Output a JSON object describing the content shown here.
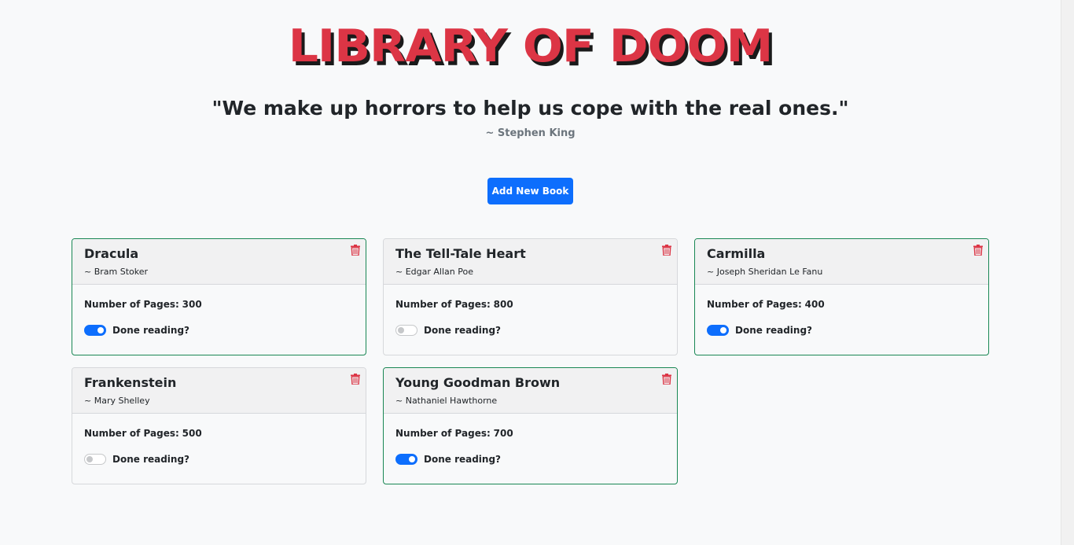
{
  "header": {
    "title": "LIBRARY OF DOOM",
    "quote": "\"We make up horrors to help us cope with the real ones.\"",
    "quote_author": "~ Stephen King"
  },
  "actions": {
    "add_book_label": "Add New Book"
  },
  "books": [
    {
      "title": "Dracula",
      "author": "~ Bram Stoker",
      "pages_label": "Number of Pages:",
      "pages": "300",
      "done_label": "Done reading?",
      "done": true
    },
    {
      "title": "The Tell-Tale Heart",
      "author": "~ Edgar Allan Poe",
      "pages_label": "Number of Pages:",
      "pages": "800",
      "done_label": "Done reading?",
      "done": false
    },
    {
      "title": "Carmilla",
      "author": "~ Joseph Sheridan Le Fanu",
      "pages_label": "Number of Pages:",
      "pages": "400",
      "done_label": "Done reading?",
      "done": true
    },
    {
      "title": "Frankenstein",
      "author": "~ Mary Shelley",
      "pages_label": "Number of Pages:",
      "pages": "500",
      "done_label": "Done reading?",
      "done": false
    },
    {
      "title": "Young Goodman Brown",
      "author": "~ Nathaniel Hawthorne",
      "pages_label": "Number of Pages:",
      "pages": "700",
      "done_label": "Done reading?",
      "done": true
    }
  ],
  "colors": {
    "accent": "#dc3545",
    "primary": "#0d6efd",
    "done_border": "#198754",
    "trash": "#dc3545"
  },
  "icons": {
    "delete": "trash-icon"
  }
}
